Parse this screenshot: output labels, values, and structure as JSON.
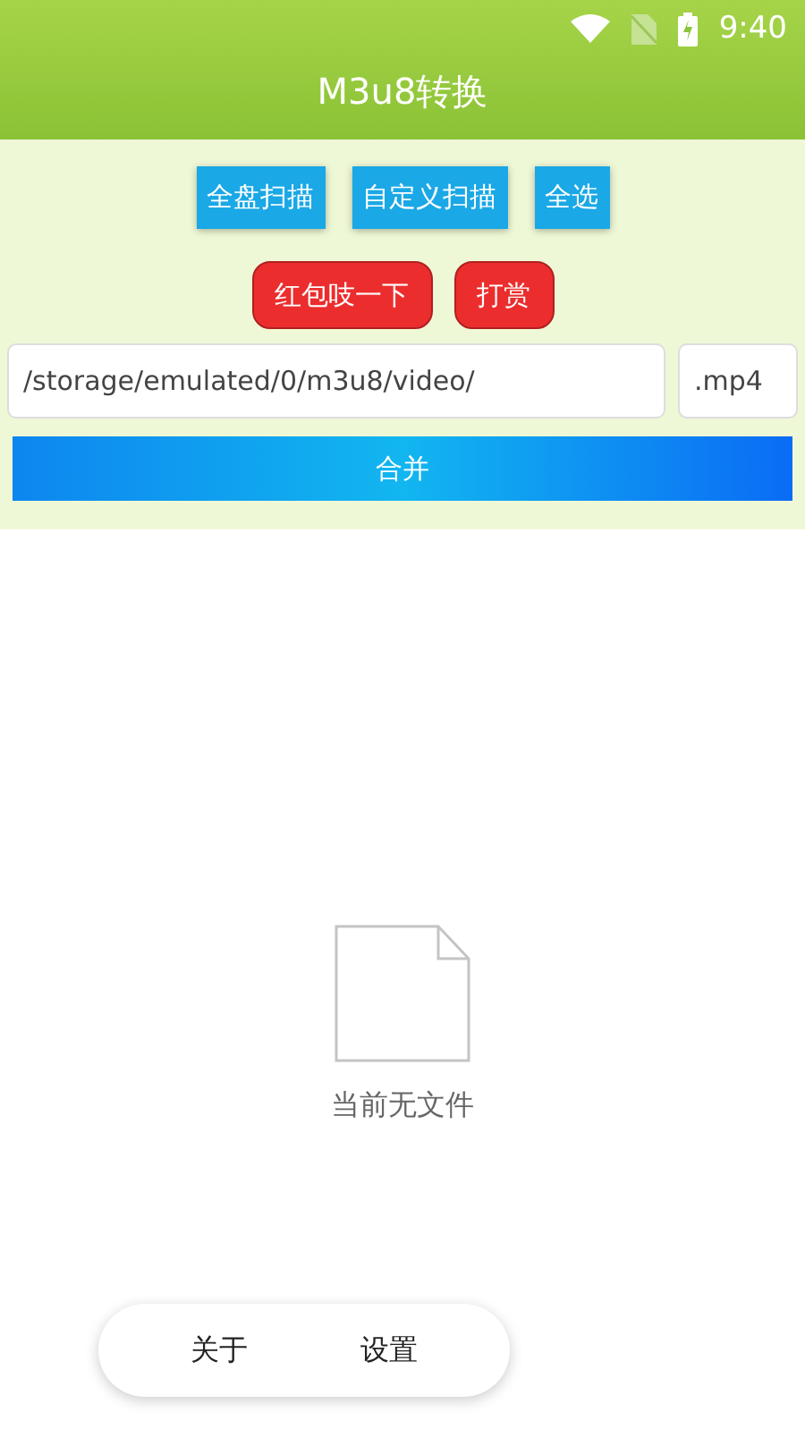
{
  "status_bar": {
    "time": "9:40"
  },
  "app_bar": {
    "title": "M3u8转换"
  },
  "scan_buttons": [
    {
      "label": "全盘扫描",
      "kind": "blue"
    },
    {
      "label": "自定义扫描",
      "kind": "blue"
    },
    {
      "label": "全选",
      "kind": "blue"
    }
  ],
  "extra_buttons": [
    {
      "label": "红包吱一下",
      "kind": "red"
    },
    {
      "label": "打赏",
      "kind": "red"
    }
  ],
  "path_field": {
    "value": "/storage/emulated/0/m3u8/video/"
  },
  "extension_field": {
    "value": ".mp4"
  },
  "merge_button": {
    "label": "合并"
  },
  "empty_state": {
    "message": "当前无文件"
  },
  "bottom_nav": [
    {
      "label": "关于"
    },
    {
      "label": "设置"
    }
  ]
}
